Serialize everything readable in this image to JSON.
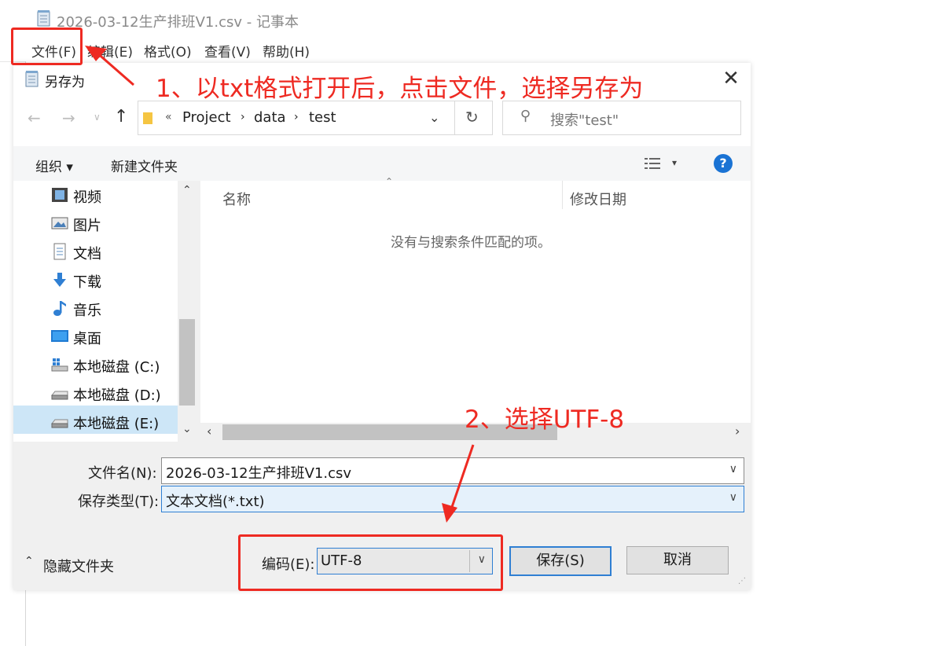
{
  "notepad": {
    "title": "2026-03-12生产排班V1.csv - 记事本",
    "menu": [
      "文件(F)",
      "编辑(E)",
      "格式(O)",
      "查看(V)",
      "帮助(H)"
    ]
  },
  "dialog": {
    "title": "另存为",
    "breadcrumb": [
      "«",
      "Project",
      "data",
      "test"
    ],
    "search_placeholder": "搜索\"test\"",
    "toolbar": {
      "organize": "组织 ▾",
      "new_folder": "新建文件夹"
    },
    "nav_items": [
      {
        "label": "视频",
        "icon": "video-icon"
      },
      {
        "label": "图片",
        "icon": "picture-icon"
      },
      {
        "label": "文档",
        "icon": "document-icon"
      },
      {
        "label": "下载",
        "icon": "download-icon"
      },
      {
        "label": "音乐",
        "icon": "music-icon"
      },
      {
        "label": "桌面",
        "icon": "desktop-icon"
      },
      {
        "label": "本地磁盘 (C:)",
        "icon": "drive-icon"
      },
      {
        "label": "本地磁盘 (D:)",
        "icon": "drive-icon"
      },
      {
        "label": "本地磁盘 (E:)",
        "icon": "drive-icon",
        "selected": true
      }
    ],
    "columns": [
      "名称",
      "修改日期"
    ],
    "empty_message": "没有与搜索条件匹配的项。",
    "filename_label": "文件名(N):",
    "filename_value": "2026-03-12生产排班V1.csv",
    "filetype_label": "保存类型(T):",
    "filetype_value": "文本文档(*.txt)",
    "hide_folders": "隐藏文件夹",
    "encoding_label": "编码(E):",
    "encoding_value": "UTF-8",
    "save_button": "保存(S)",
    "cancel_button": "取消"
  },
  "annotations": {
    "step1": "1、以txt格式打开后，点击文件，选择另存为",
    "step2": "2、选择UTF-8",
    "color": "#ee2a22"
  }
}
